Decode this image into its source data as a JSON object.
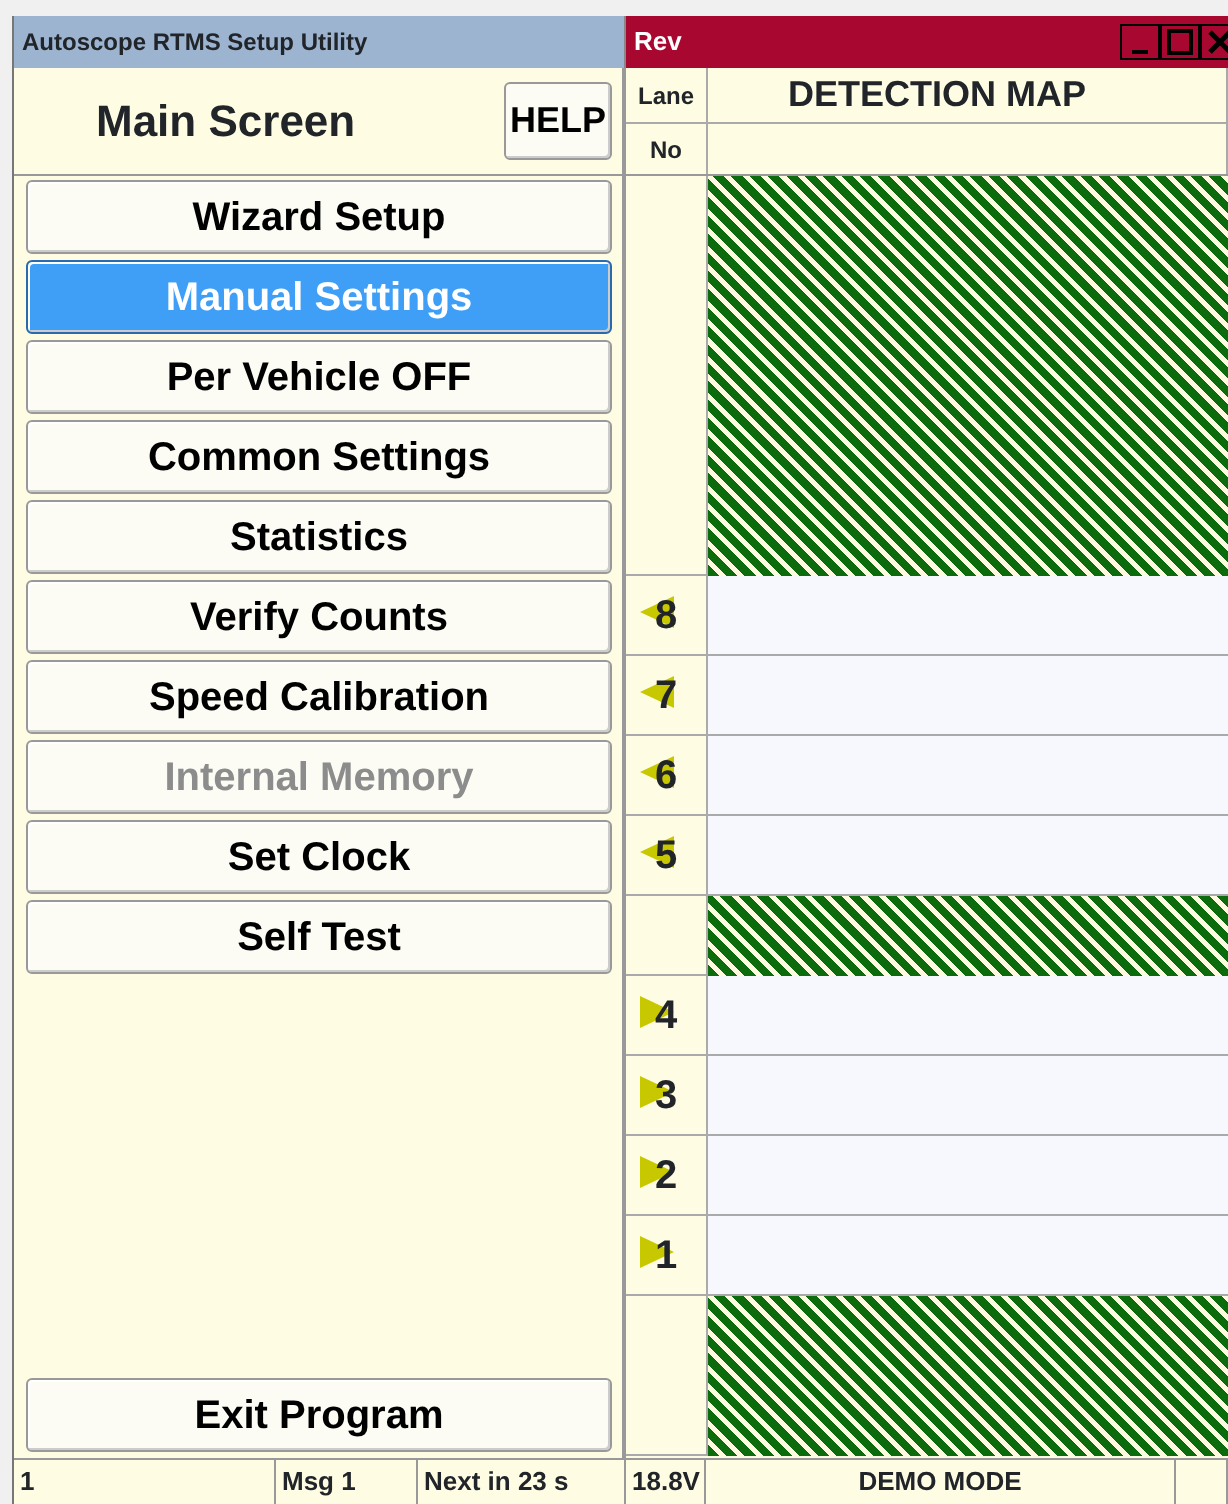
{
  "window": {
    "title": "Autoscope RTMS Setup Utility",
    "map_title": "Rev"
  },
  "header": {
    "title": "Main Screen",
    "help": "HELP"
  },
  "menu": [
    {
      "label": "Wizard Setup",
      "selected": false,
      "disabled": false
    },
    {
      "label": "Manual Settings",
      "selected": true,
      "disabled": false
    },
    {
      "label": "Per Vehicle OFF",
      "selected": false,
      "disabled": false
    },
    {
      "label": "Common Settings",
      "selected": false,
      "disabled": false
    },
    {
      "label": "Statistics",
      "selected": false,
      "disabled": false
    },
    {
      "label": "Verify Counts",
      "selected": false,
      "disabled": false
    },
    {
      "label": "Speed Calibration",
      "selected": false,
      "disabled": false
    },
    {
      "label": "Internal Memory",
      "selected": false,
      "disabled": true
    },
    {
      "label": "Set Clock",
      "selected": false,
      "disabled": false
    },
    {
      "label": "Self Test",
      "selected": false,
      "disabled": false
    }
  ],
  "exit_button": "Exit Program",
  "map": {
    "lane_heading": "Lane",
    "no_heading": "No",
    "title": "DETECTION MAP",
    "rows": [
      {
        "kind": "median"
      },
      {
        "kind": "median"
      },
      {
        "kind": "median"
      },
      {
        "kind": "median"
      },
      {
        "kind": "median"
      },
      {
        "kind": "lane",
        "label": "8",
        "points_left": true
      },
      {
        "kind": "lane",
        "label": "7",
        "points_left": true
      },
      {
        "kind": "lane",
        "label": "6",
        "points_left": true
      },
      {
        "kind": "lane",
        "label": "5",
        "points_left": true
      },
      {
        "kind": "median"
      },
      {
        "kind": "lane",
        "label": "4",
        "points_left": false
      },
      {
        "kind": "lane",
        "label": "3",
        "points_left": false
      },
      {
        "kind": "lane",
        "label": "2",
        "points_left": false
      },
      {
        "kind": "lane",
        "label": "1",
        "points_left": false
      },
      {
        "kind": "median"
      },
      {
        "kind": "median"
      }
    ]
  },
  "status_bar": [
    "1",
    "Msg 1",
    "Next in 23 s",
    "18.8V",
    "DEMO MODE"
  ]
}
